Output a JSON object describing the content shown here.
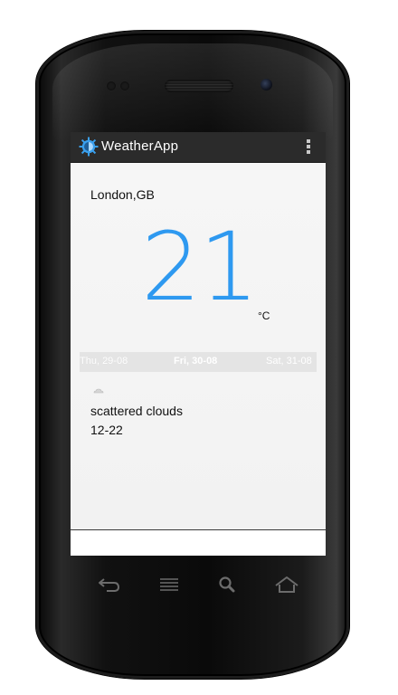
{
  "action_bar": {
    "title": "WeatherApp",
    "app_icon": "sun-gear-icon",
    "overflow_icon": "overflow-menu-icon"
  },
  "weather": {
    "city": "London,GB",
    "temperature": "21",
    "unit": "°C",
    "condition": "scattered clouds",
    "range": "12-22",
    "condition_icon": "cloud-icon"
  },
  "days": {
    "previous": "Thu, 29-08",
    "current": "Fri, 30-08",
    "next": "Sat, 31-08"
  },
  "hardware_keys": [
    "back-icon",
    "menu-icon",
    "search-icon",
    "home-icon"
  ],
  "colors": {
    "accent": "#2e99f0",
    "action_bar": "#2b2b2b",
    "day_strip": "#e4e4e4"
  }
}
